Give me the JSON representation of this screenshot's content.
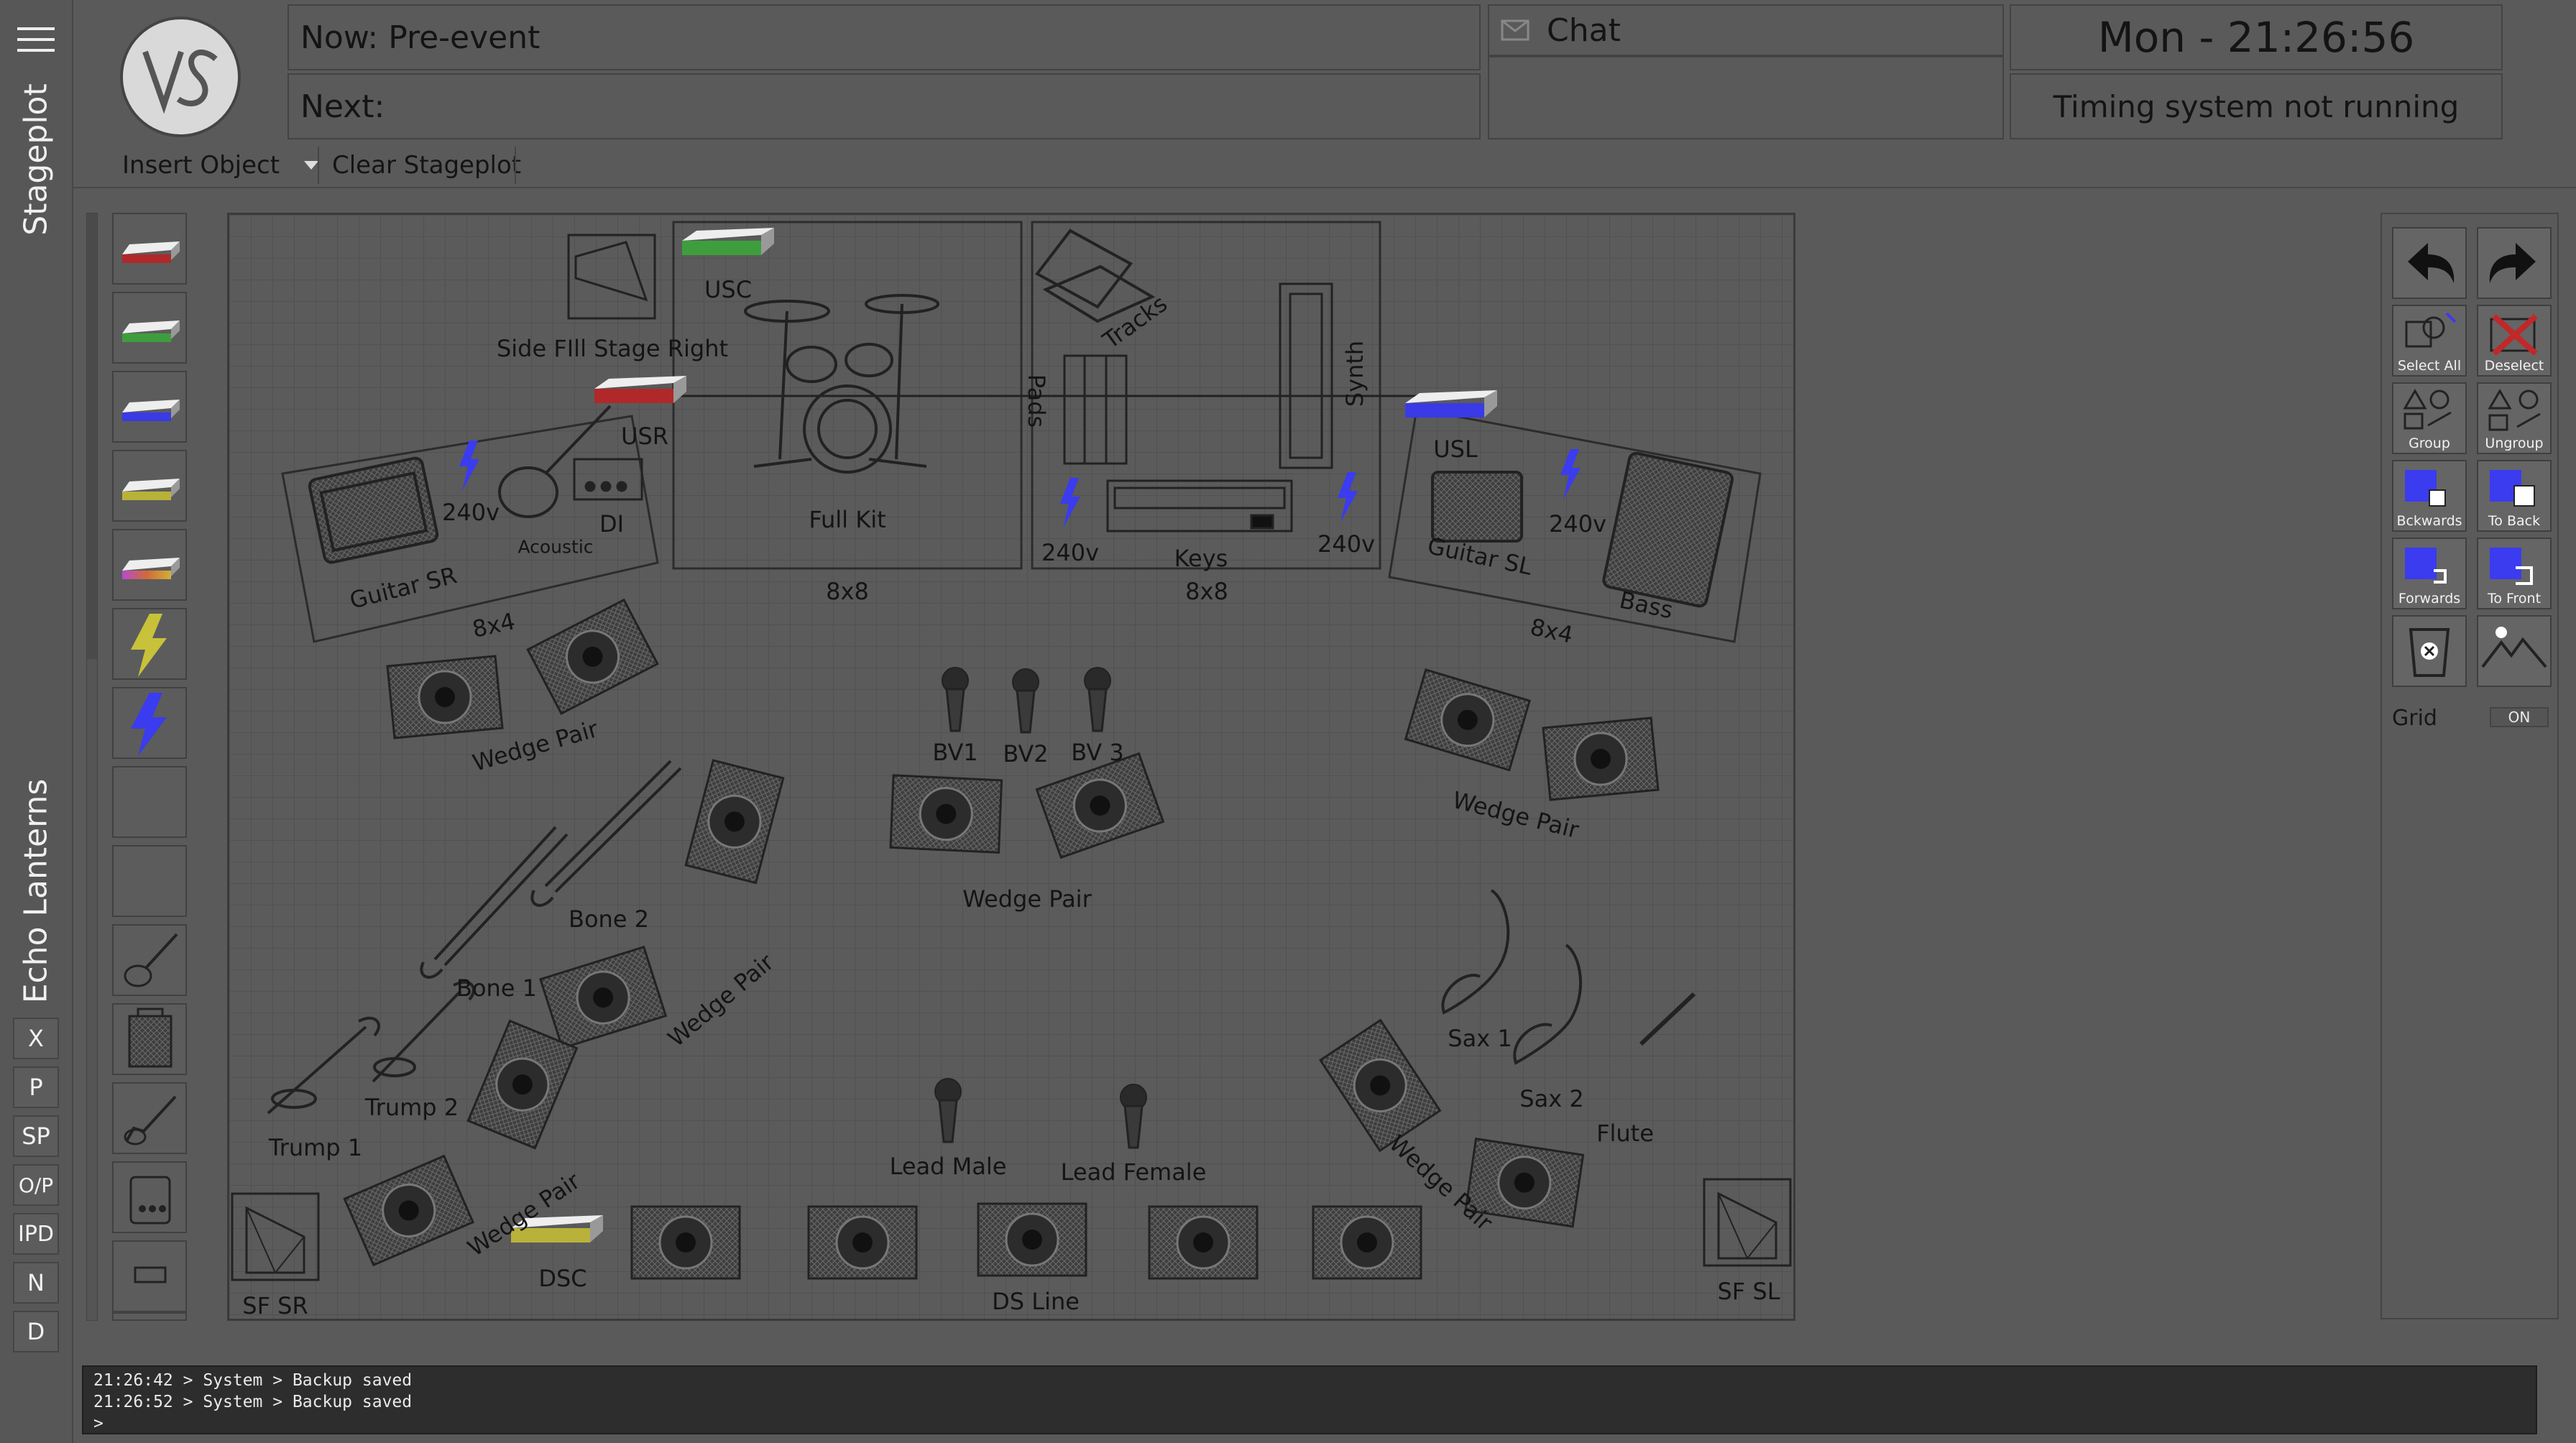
{
  "sidebar": {
    "top_label": "Stageplot",
    "bottom_label": "Echo Lanterns",
    "buttons": [
      "X",
      "P",
      "SP",
      "O/P",
      "IPD",
      "N",
      "D"
    ]
  },
  "header": {
    "now": "Now: Pre-event",
    "next": "Next:",
    "chat_title": "Chat",
    "clock": "Mon - 21:26:56",
    "timing_status": "Timing system not running"
  },
  "toolbar": {
    "insert_object": "Insert Object",
    "clear_stageplot": "Clear Stageplot"
  },
  "stage": {
    "side_fill_sr": "Side FIll Stage Right",
    "usc": "USC",
    "usr": "USR",
    "usl": "USL",
    "dsc": "DSC",
    "full_kit": "Full Kit",
    "riser_drums": "8x8",
    "tracks": "Tracks",
    "pads": "Pads",
    "synth": "Synth",
    "keys": "Keys",
    "riser_keys": "8x8",
    "guitar_sr": "Guitar SR",
    "acoustic": "Acoustic",
    "di": "DI",
    "riser_sr": "8x4",
    "guitar_sl": "Guitar SL",
    "bass": "Bass",
    "riser_sl": "8x4",
    "power": "240v",
    "wedge_pair": "Wedge Pair",
    "bv1": "BV1",
    "bv2": "BV2",
    "bv3": "BV 3",
    "bone1": "Bone 1",
    "bone2": "Bone 2",
    "trump1": "Trump 1",
    "trump2": "Trump 2",
    "sax1": "Sax 1",
    "sax2": "Sax 2",
    "flute": "Flute",
    "lead_male": "Lead Male",
    "lead_female": "Lead Female",
    "ds_line": "DS Line",
    "sf_sr": "SF SR",
    "sf_sl": "SF SL"
  },
  "tools": {
    "select_all": "Select All",
    "deselect": "Deselect",
    "group": "Group",
    "ungroup": "Ungroup",
    "backwards": "Bckwards",
    "to_back": "To Back",
    "forwards": "Forwards",
    "to_front": "To Front",
    "grid_label": "Grid",
    "grid_state": "ON"
  },
  "console": {
    "lines": [
      "21:26:42 > System > Backup saved",
      "21:26:52 > System > Backup saved",
      ">"
    ]
  },
  "colors": {
    "accent_blue": "#3b3bf0",
    "stagebox_red": "#b0282a",
    "stagebox_green": "#3e9e3e",
    "stagebox_blue": "#3a3ae6",
    "stagebox_yellow": "#b8b23a",
    "power_yellow": "#c8c23a"
  }
}
